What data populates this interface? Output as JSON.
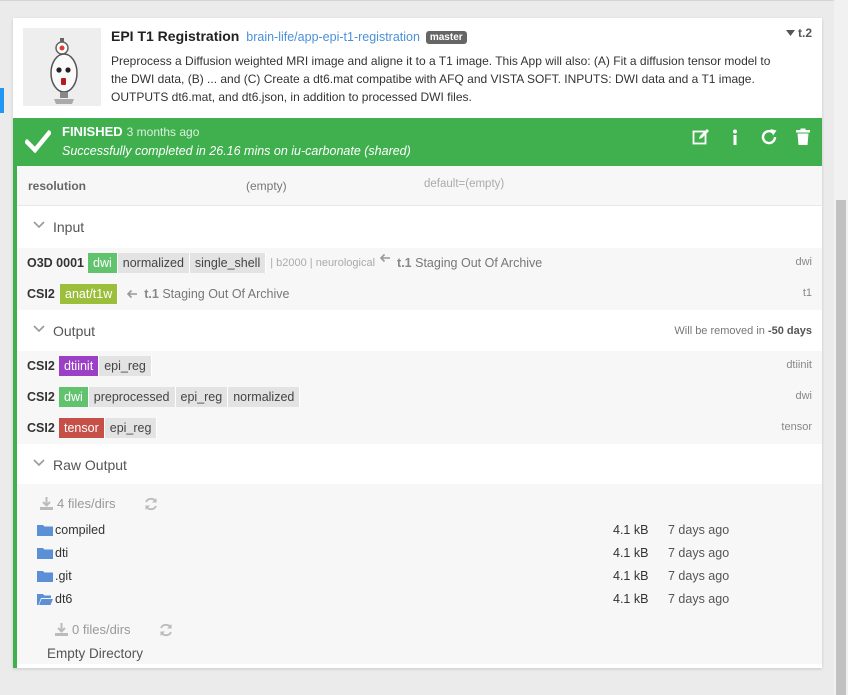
{
  "app": {
    "name": "EPI T1 Registration",
    "repo": "brain-life/app-epi-t1-registration",
    "branch": "master",
    "task_id": "t.2",
    "description": "Preprocess a Diffusion weighted MRI image and aligne it to a T1 image. This App will also: (A) Fit a diffusion tensor model to the DWI data, (B) ... and (C) Create a dt6.mat compatibe with AFQ and VISTA SOFT. INPUTS: DWI data and a T1 image. OUTPUTS dt6.mat, and dt6.json, in addition to processed DWI files."
  },
  "status": {
    "state": "FINISHED",
    "since": "3 months ago",
    "message": "Successfully completed in 26.16 mins on iu-carbonate (shared)",
    "color": "#40b04f"
  },
  "config": {
    "key": "resolution",
    "value": "(empty)",
    "default": "default=(empty)"
  },
  "input": {
    "title": "Input",
    "rows": [
      {
        "subject": "O3D 0001",
        "datatype_tag": "dwi",
        "tags": [
          "normalized",
          "single_shell"
        ],
        "meta": "| b2000 | neurological",
        "from_task": "t.1",
        "from_name": "Staging Out Of Archive",
        "id": "dwi"
      },
      {
        "subject": "CSI2",
        "datatype_tag": "anat/t1w",
        "tags": [],
        "meta": "",
        "from_task": "t.1",
        "from_name": "Staging Out Of Archive",
        "id": "t1"
      }
    ]
  },
  "output": {
    "title": "Output",
    "removal_prefix": "Will be removed in",
    "removal_days": "-50 days",
    "rows": [
      {
        "subject": "CSI2",
        "datatype_tag": "dtiinit",
        "tags": [
          "epi_reg"
        ],
        "id": "dtiinit"
      },
      {
        "subject": "CSI2",
        "datatype_tag": "dwi",
        "tags": [
          "preprocessed",
          "epi_reg",
          "normalized"
        ],
        "id": "dwi"
      },
      {
        "subject": "CSI2",
        "datatype_tag": "tensor",
        "tags": [
          "epi_reg"
        ],
        "id": "tensor"
      }
    ]
  },
  "raw": {
    "title": "Raw Output",
    "count": "4 files/dirs",
    "files": [
      {
        "name": "compiled",
        "size": "4.1 kB",
        "date": "7 days ago",
        "icon": "folder-icon"
      },
      {
        "name": "dti",
        "size": "4.1 kB",
        "date": "7 days ago",
        "icon": "folder-icon"
      },
      {
        "name": ".git",
        "size": "4.1 kB",
        "date": "7 days ago",
        "icon": "folder-icon"
      },
      {
        "name": "dt6",
        "size": "4.1 kB",
        "date": "7 days ago",
        "icon": "folder-open-icon"
      }
    ],
    "sub_count": "0 files/dirs",
    "empty_label": "Empty Directory"
  }
}
